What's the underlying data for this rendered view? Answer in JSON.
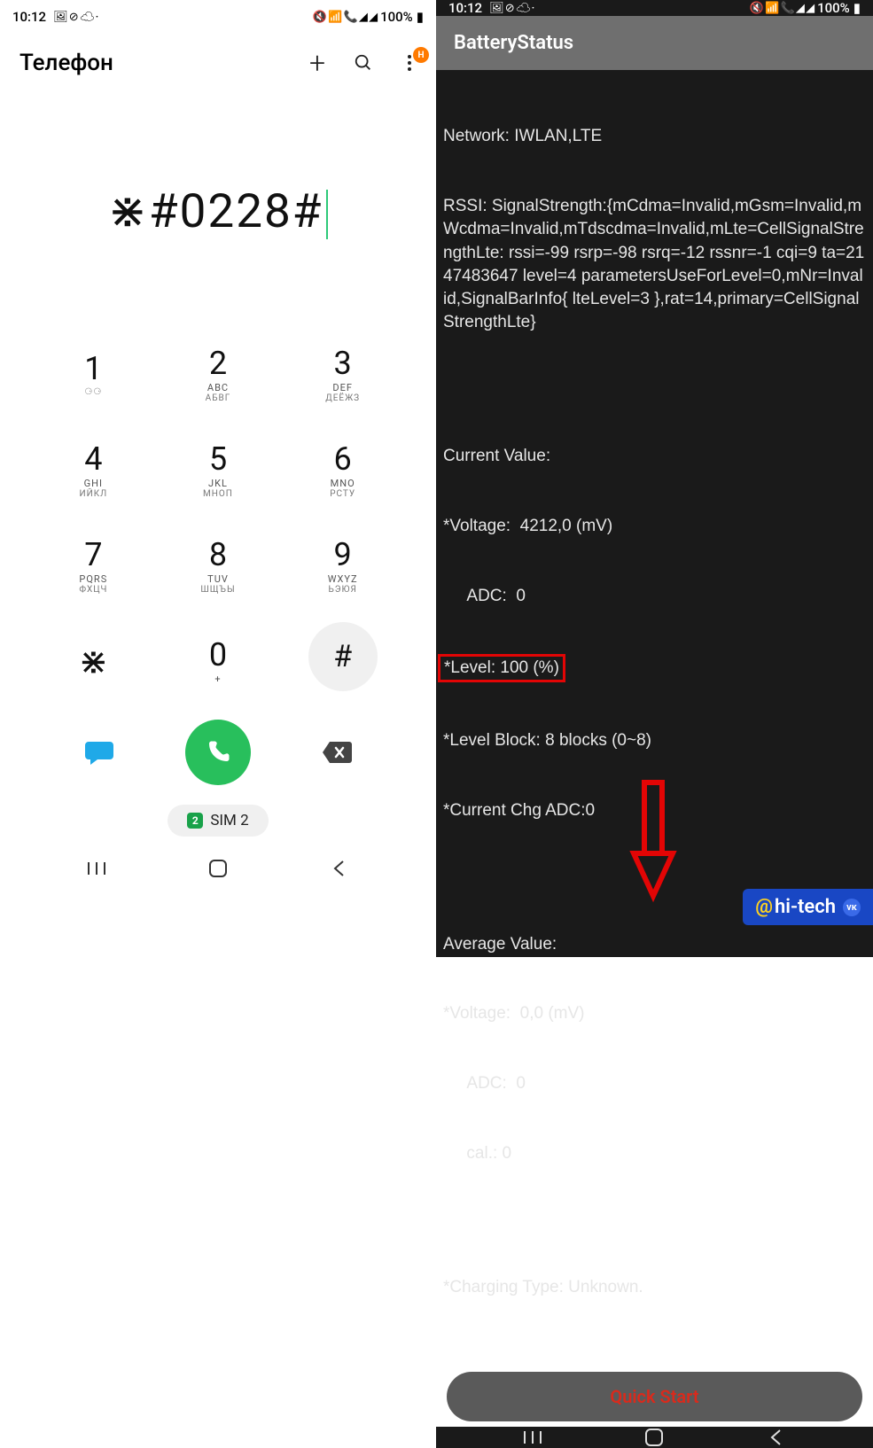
{
  "status": {
    "time": "10:12",
    "battery": "100%",
    "left_icons": "🖼 ⊘ ☁ ·",
    "right_icons": "🔇 📶 📞 ◢ ◢"
  },
  "left": {
    "title": "Телефон",
    "badge": "H",
    "input": "⋇#0228#",
    "keys": [
      {
        "d": "1",
        "s1": "",
        "s2": "⚆⚆"
      },
      {
        "d": "2",
        "s1": "ABC",
        "s2": "АБВГ"
      },
      {
        "d": "3",
        "s1": "DEF",
        "s2": "ДЕЁЖЗ"
      },
      {
        "d": "4",
        "s1": "GHI",
        "s2": "ИЙКЛ"
      },
      {
        "d": "5",
        "s1": "JKL",
        "s2": "МНОП"
      },
      {
        "d": "6",
        "s1": "MNO",
        "s2": "РСТУ"
      },
      {
        "d": "7",
        "s1": "PQRS",
        "s2": "ФХЦЧ"
      },
      {
        "d": "8",
        "s1": "TUV",
        "s2": "ШЩЪЫ"
      },
      {
        "d": "9",
        "s1": "WXYZ",
        "s2": "ЬЭЮЯ"
      },
      {
        "d": "⋇",
        "s1": "",
        "s2": ""
      },
      {
        "d": "0",
        "s1": "+",
        "s2": ""
      },
      {
        "d": "#",
        "s1": "",
        "s2": ""
      }
    ],
    "sim": {
      "num": "2",
      "label": "SIM 2"
    }
  },
  "right": {
    "title": "BatteryStatus",
    "network": "Network: IWLAN,LTE",
    "rssi": "RSSI: SignalStrength:{mCdma=Invalid,mGsm=Invalid,mWcdma=Invalid,mTdscdma=Invalid,mLte=CellSignalStrengthLte: rssi=-99 rsrp=-98 rsrq=-12 rssnr=-1 cqi=9 ta=2147483647 level=4 parametersUseForLevel=0,mNr=Invalid,SignalBarInfo{ lteLevel=3 },rat=14,primary=CellSignalStrengthLte}",
    "cv_label": "Current Value:",
    "cv_voltage": "*Voltage:  4212,0 (mV)",
    "cv_adc": "     ADC:  0",
    "cv_level": "*Level: 100 (%)",
    "cv_levelblock": "*Level Block: 8 blocks (0~8)",
    "cv_chgadc": "*Current Chg ADC:0",
    "av_label": "Average Value:",
    "av_voltage": "*Voltage:  0,0 (mV)",
    "av_adc": "     ADC:  0",
    "av_cal": "     cal.: 0",
    "charging": "*Charging Type: Unknown.",
    "button": "Quick Start"
  },
  "watermark": {
    "at": "@",
    "text": "hi-tech",
    "sub": "vк"
  }
}
